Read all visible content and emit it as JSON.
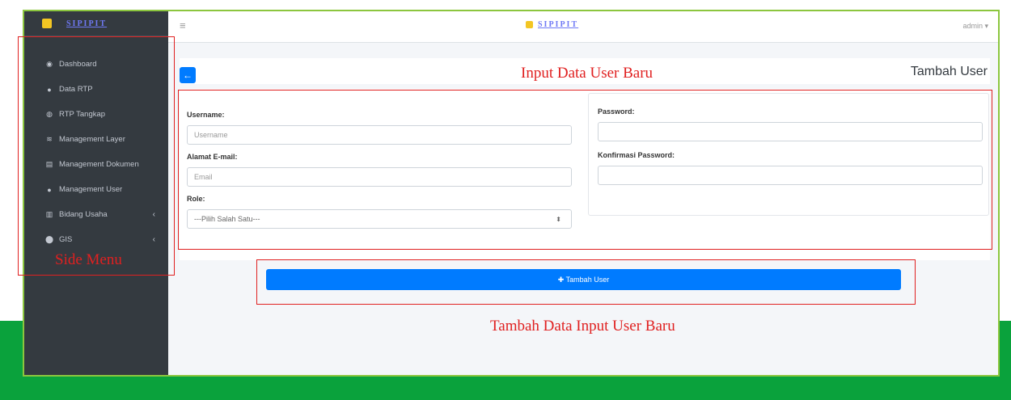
{
  "brand": {
    "name": "SIPIPIT"
  },
  "sidebar": {
    "items": [
      {
        "label": "Dashboard",
        "icon": "dashboard-icon",
        "glyph": "◉"
      },
      {
        "label": "Data RTP",
        "icon": "user-icon",
        "glyph": "●"
      },
      {
        "label": "RTP Tangkap",
        "icon": "circle-icon",
        "glyph": "◍"
      },
      {
        "label": "Management Layer",
        "icon": "layers-icon",
        "glyph": "≋"
      },
      {
        "label": "Management Dokumen",
        "icon": "document-icon",
        "glyph": "▤"
      },
      {
        "label": "Management User",
        "icon": "user-icon",
        "glyph": "●"
      },
      {
        "label": "Bidang Usaha",
        "icon": "chart-icon",
        "glyph": "▥",
        "chevron": "‹"
      },
      {
        "label": "GIS",
        "icon": "map-marker-icon",
        "glyph": "⬤",
        "chevron": "‹"
      }
    ]
  },
  "topbar": {
    "menu_glyph": "≡",
    "user": "admin ▾"
  },
  "header": {
    "back_glyph": "←",
    "title": "Tambah User"
  },
  "form": {
    "username": {
      "label": "Username:",
      "placeholder": "Username"
    },
    "email": {
      "label": "Alamat E-mail:",
      "placeholder": "Email"
    },
    "role": {
      "label": "Role:",
      "selected": "---Pilih Salah Satu---",
      "arrow": "⬍"
    },
    "password": {
      "label": "Password:",
      "placeholder": ""
    },
    "confirm": {
      "label": "Konfirmasi Password:",
      "placeholder": ""
    },
    "submit": "✚ Tambah User"
  },
  "annotations": {
    "side_menu": "Side Menu",
    "input_data": "Input Data User Baru",
    "tambah_data": "Tambah Data Input User Baru"
  },
  "colors": {
    "primary": "#007bff",
    "sidebar": "#343a40",
    "green": "#0aa23c",
    "annotation": "#e02020"
  }
}
